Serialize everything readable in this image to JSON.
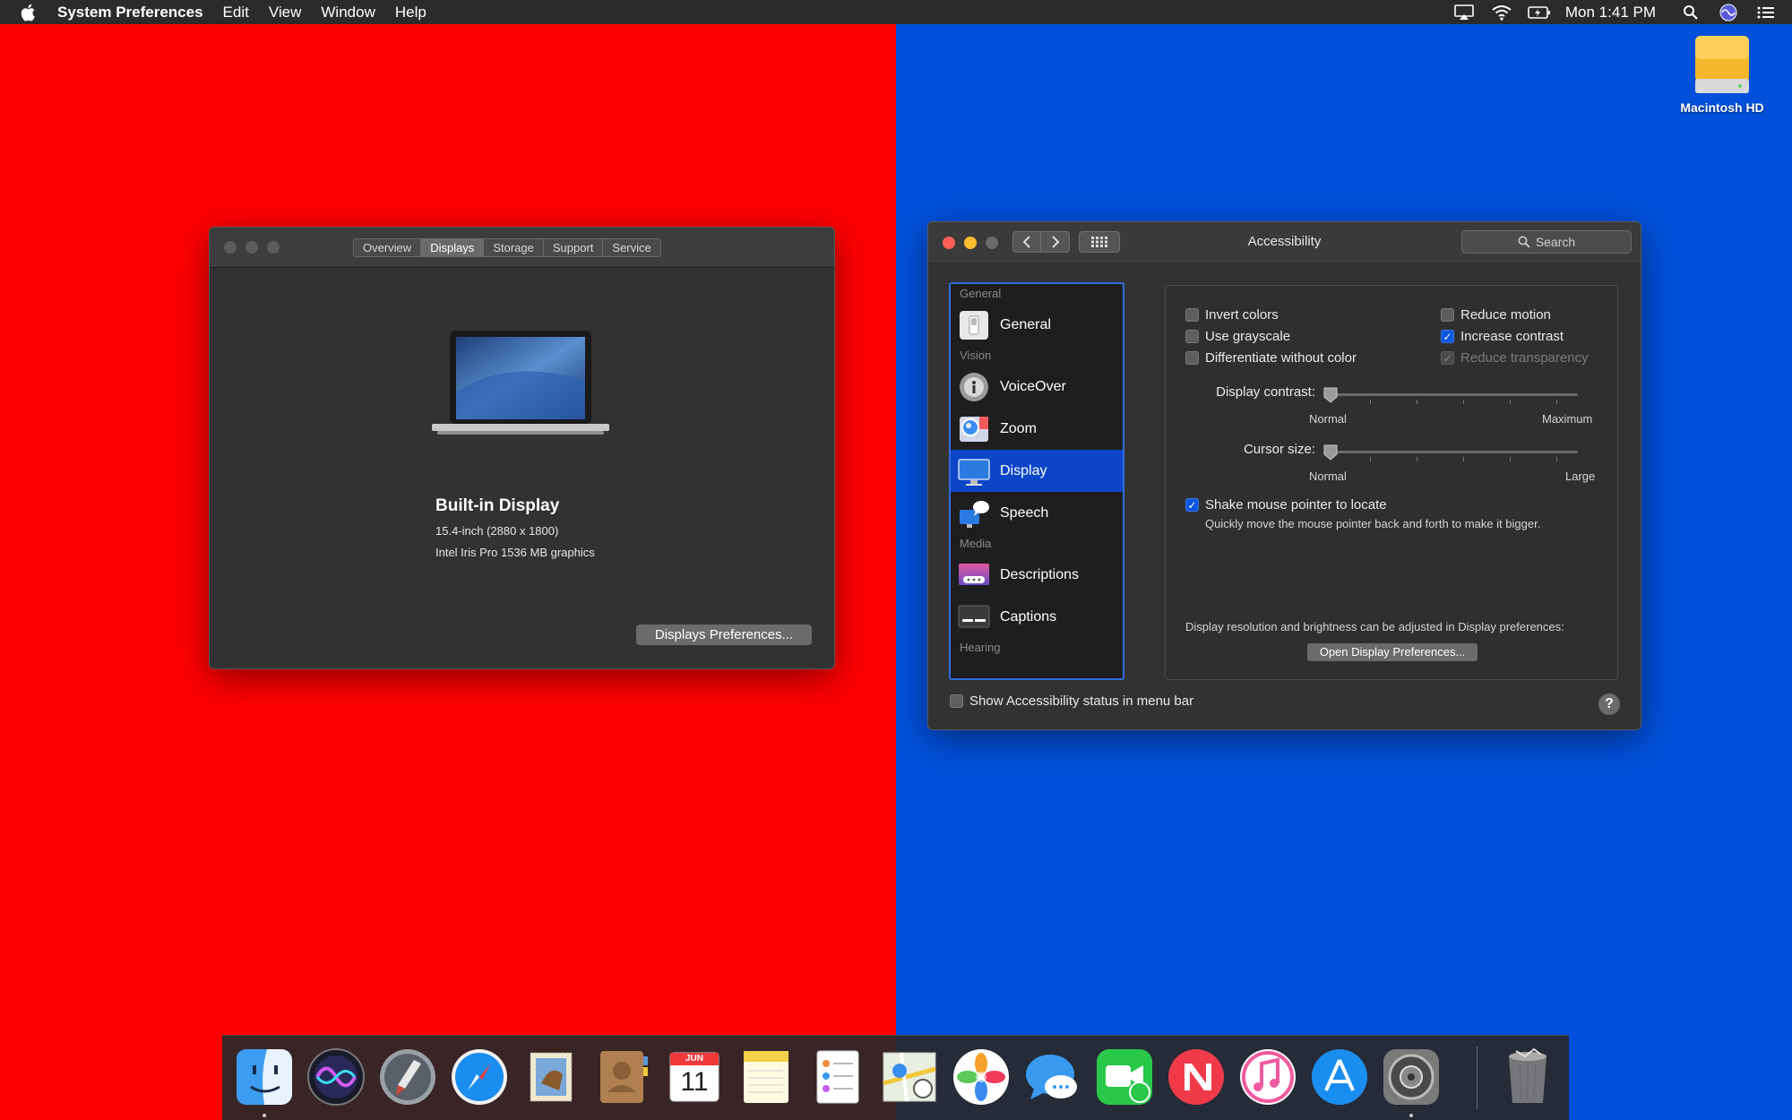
{
  "menubar": {
    "app_name": "System Preferences",
    "menus": [
      "Edit",
      "View",
      "Window",
      "Help"
    ],
    "clock": "Mon 1:41 PM",
    "status_icons": [
      "airplay-icon",
      "wifi-icon",
      "battery-icon",
      "spotlight-icon",
      "siri-icon",
      "notification-center-icon"
    ]
  },
  "desktop": {
    "left_color": "#ff0000",
    "right_color": "#0050dc",
    "drive_label": "Macintosh HD"
  },
  "about_window": {
    "tabs": [
      "Overview",
      "Displays",
      "Storage",
      "Support",
      "Service"
    ],
    "active_tab": "Displays",
    "display_name": "Built-in Display",
    "display_size": "15.4-inch (2880 x 1800)",
    "graphics": "Intel Iris Pro 1536 MB graphics",
    "prefs_button": "Displays Preferences..."
  },
  "accessibility_window": {
    "title": "Accessibility",
    "search_placeholder": "Search",
    "sidebar": {
      "sections": {
        "general": "General",
        "vision": "Vision",
        "media": "Media",
        "hearing": "Hearing"
      },
      "items": {
        "general": "General",
        "voiceover": "VoiceOver",
        "zoom": "Zoom",
        "display": "Display",
        "speech": "Speech",
        "descriptions": "Descriptions",
        "captions": "Captions"
      },
      "selected": "Display"
    },
    "options": {
      "invert_colors": "Invert colors",
      "use_grayscale": "Use grayscale",
      "differentiate": "Differentiate without color",
      "reduce_motion": "Reduce motion",
      "increase_contrast": "Increase contrast",
      "reduce_transparency": "Reduce transparency",
      "states": {
        "invert_colors": false,
        "use_grayscale": false,
        "differentiate": false,
        "reduce_motion": false,
        "increase_contrast": true,
        "reduce_transparency": true
      }
    },
    "display_contrast": {
      "label": "Display contrast:",
      "min_label": "Normal",
      "max_label": "Maximum",
      "value": 0
    },
    "cursor_size": {
      "label": "Cursor size:",
      "min_label": "Normal",
      "max_label": "Large",
      "value": 0
    },
    "shake": {
      "label": "Shake mouse pointer to locate",
      "description": "Quickly move the mouse pointer back and forth to make it bigger.",
      "checked": true
    },
    "display_note": "Display resolution and brightness can be adjusted in Display preferences:",
    "open_display_button": "Open Display Preferences...",
    "status_menu_label": "Show Accessibility status in menu bar",
    "status_menu_checked": false,
    "help": "?"
  },
  "dock": {
    "apps": [
      "finder-icon",
      "siri-icon",
      "launchpad-icon",
      "safari-icon",
      "mail-icon",
      "contacts-icon",
      "calendar-icon",
      "notes-icon",
      "reminders-icon",
      "maps-icon",
      "photos-icon",
      "messages-icon",
      "facetime-icon",
      "news-icon",
      "itunes-icon",
      "app-store-icon",
      "system-preferences-icon",
      "trash-icon"
    ],
    "calendar_month": "JUN",
    "calendar_day": "11"
  }
}
